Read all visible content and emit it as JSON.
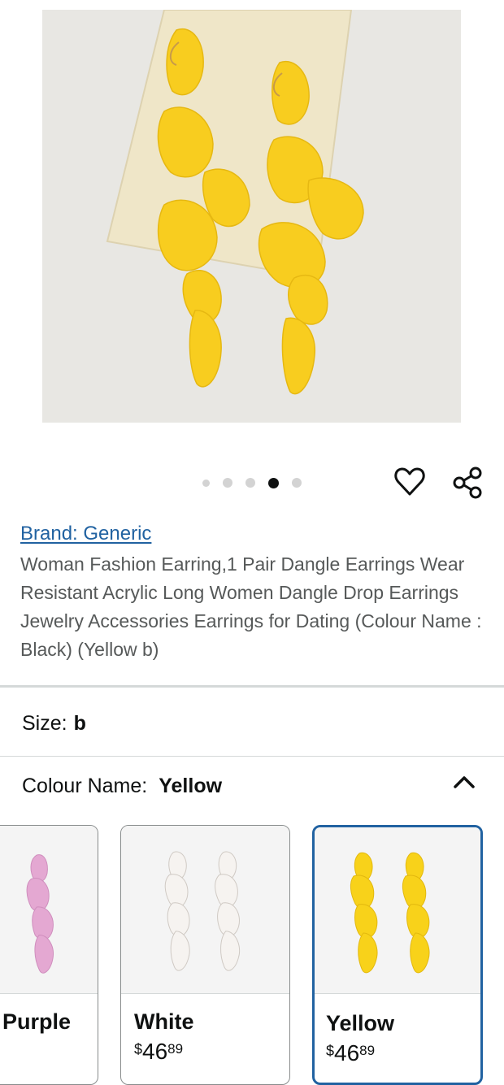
{
  "product_image": {
    "alt_icon": "yellow-petal-earrings"
  },
  "carousel": {
    "count": 5,
    "active_index": 3
  },
  "actions": {
    "wishlist_icon": "heart-icon",
    "share_icon": "share-icon"
  },
  "brand_link": "Brand: Generic",
  "product_title": "Woman Fashion Earring,1 Pair Dangle Earrings Wear Resistant Acrylic Long Women Dangle Drop Earrings Jewelry Accessories Earrings for Dating (Colour Name : Black) (Yellow b)",
  "size": {
    "label": "Size:",
    "value": "b"
  },
  "colour": {
    "label": "Colour Name:",
    "value": "Yellow",
    "toggle_icon": "chevron-up-icon"
  },
  "swatches": [
    {
      "name": "Purple",
      "color": "#e2a9d0",
      "price_symbol": "",
      "price_whole": "",
      "price_fraction": "",
      "selected": false
    },
    {
      "name": "White",
      "color": "#f4f1ee",
      "price_symbol": "$",
      "price_whole": "46",
      "price_fraction": "89",
      "selected": false
    },
    {
      "name": "Yellow",
      "color": "#f7d31b",
      "price_symbol": "$",
      "price_whole": "46",
      "price_fraction": "89",
      "selected": true
    }
  ],
  "colors": {
    "link": "#2162a1",
    "selected_border": "#2162a1",
    "petal_yellow": "#f7cf1e"
  }
}
